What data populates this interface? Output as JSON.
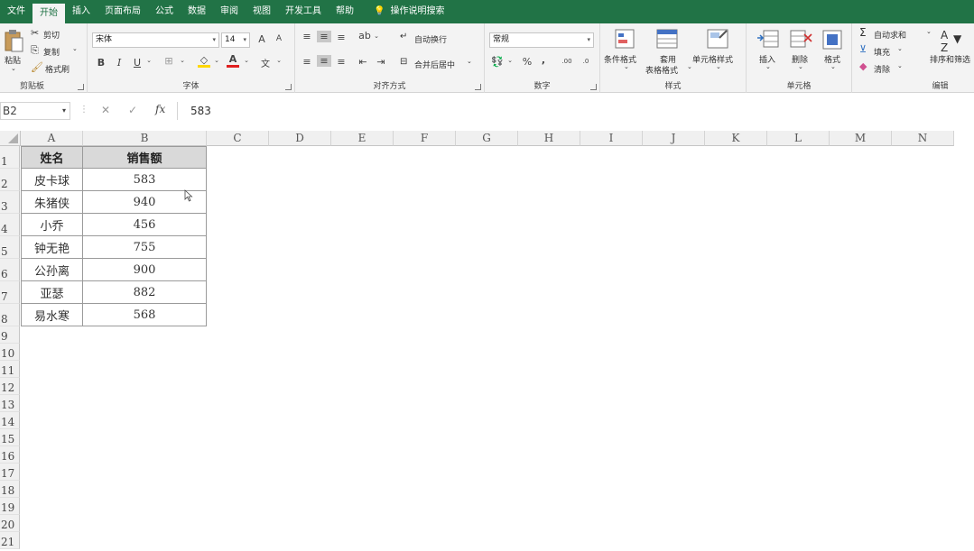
{
  "tabs": [
    {
      "label": "文件"
    },
    {
      "label": "开始"
    },
    {
      "label": "插入"
    },
    {
      "label": "页面布局"
    },
    {
      "label": "公式"
    },
    {
      "label": "数据"
    },
    {
      "label": "审阅"
    },
    {
      "label": "视图"
    },
    {
      "label": "开发工具"
    },
    {
      "label": "帮助"
    },
    {
      "label": "操作说明搜索"
    }
  ],
  "clipboard": {
    "paste": "粘贴",
    "cut": "剪切",
    "copy": "复制",
    "format_painter": "格式刷",
    "label": "剪贴板"
  },
  "font": {
    "name": "宋体",
    "size": "14",
    "bold": "B",
    "italic": "I",
    "underline": "U",
    "label": "字体",
    "font_color_glyph": "A",
    "phonetic": "文",
    "grow": "A",
    "shrink": "A"
  },
  "alignment": {
    "wrap": "自动换行",
    "merge": "合并后居中",
    "label": "对齐方式"
  },
  "number": {
    "format": "常规",
    "percent": "%",
    "comma": ",",
    "inc_dec": ".00",
    "dec_dec": ".0",
    "label": "数字"
  },
  "styles": {
    "conditional": "条件格式",
    "table": "套用",
    "table2": "表格格式",
    "cell": "单元格样式",
    "label": "样式"
  },
  "cells": {
    "insert": "插入",
    "delete": "删除",
    "format": "格式",
    "label": "单元格"
  },
  "editing": {
    "autosum": "自动求和",
    "fill": "填充",
    "clear": "清除",
    "sort": "排序和筛选",
    "label": "编辑",
    "sigma": "Σ"
  },
  "formula_bar": {
    "name_box": "B2",
    "fx": "fx",
    "cancel": "✕",
    "confirm": "✓",
    "value": "583"
  },
  "columns": [
    "A",
    "B",
    "C",
    "D",
    "E",
    "F",
    "G",
    "H",
    "I",
    "J",
    "K",
    "L",
    "M",
    "N"
  ],
  "rows": [
    "1",
    "2",
    "3",
    "4",
    "5",
    "6",
    "7",
    "8",
    "9",
    "10",
    "11",
    "12",
    "13",
    "14",
    "15",
    "16",
    "17",
    "18",
    "19",
    "20",
    "21"
  ],
  "table": {
    "header": [
      "姓名",
      "销售额"
    ],
    "rows": [
      [
        "皮卡球",
        "583"
      ],
      [
        "朱猪侠",
        "940"
      ],
      [
        "小乔",
        "456"
      ],
      [
        "钟无艳",
        "755"
      ],
      [
        "公孙离",
        "900"
      ],
      [
        "亚瑟",
        "882"
      ],
      [
        "易水寒",
        "568"
      ]
    ]
  },
  "colors": {
    "accent": "#217346",
    "header_fill": "#d9d9d9"
  }
}
